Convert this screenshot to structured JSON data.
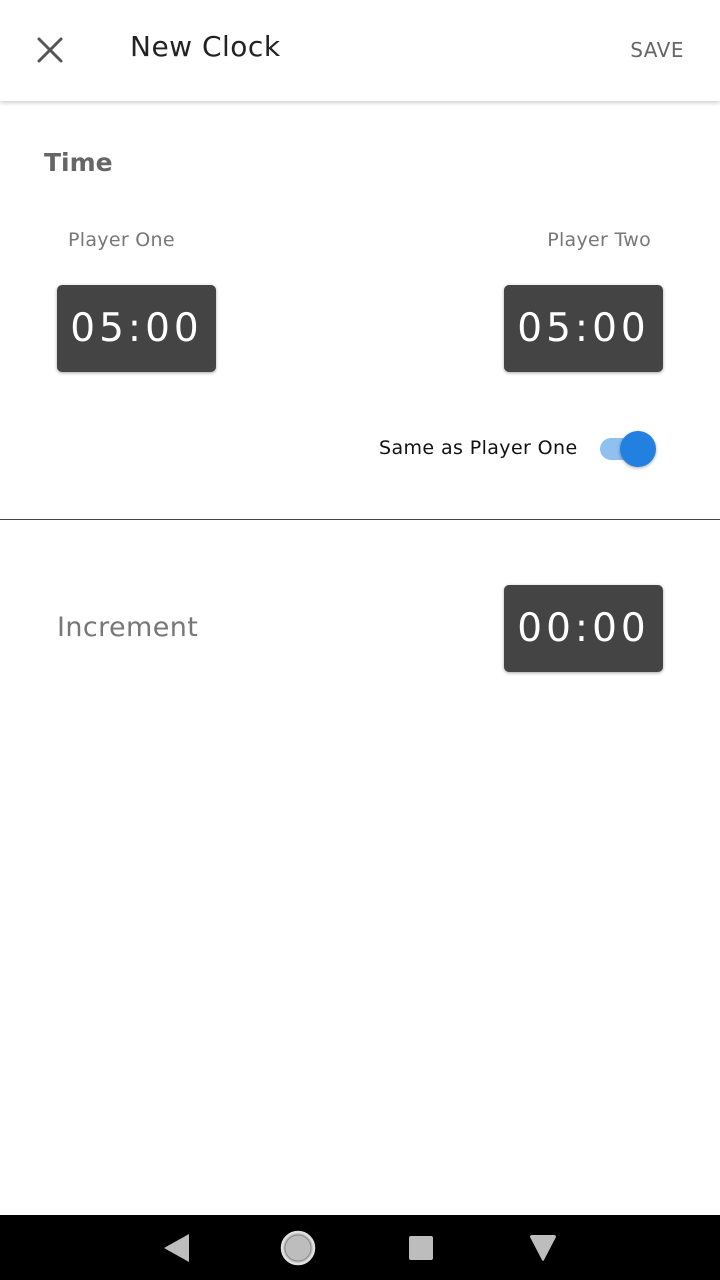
{
  "appbar": {
    "title": "New Clock",
    "save_label": "SAVE",
    "close_icon": "close-icon"
  },
  "time_section": {
    "title": "Time",
    "player_one": {
      "label": "Player One",
      "time": "05:00"
    },
    "player_two": {
      "label": "Player Two",
      "time": "05:00"
    },
    "same_as_player_one": {
      "label": "Same as Player One",
      "enabled": true
    }
  },
  "increment_section": {
    "label": "Increment",
    "time": "00:00"
  },
  "colors": {
    "time_box": "#444444",
    "toggle_thumb": "#2281e0",
    "toggle_track": "#8fc0f0"
  },
  "navbar": {
    "icons": [
      "back-icon",
      "home-icon",
      "recents-icon",
      "notification-icon"
    ]
  }
}
